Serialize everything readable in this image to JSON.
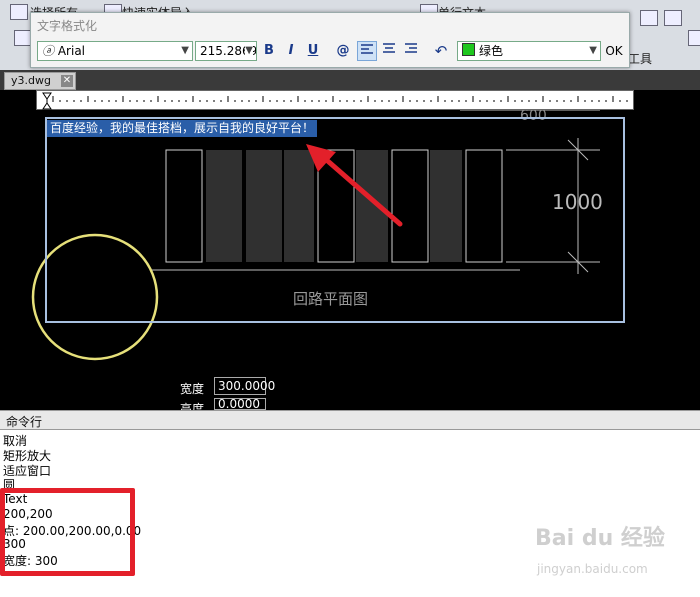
{
  "ribbon": {
    "select_all": "选择所有",
    "quick_import": "快速实体导入",
    "single_text": "单行文本",
    "tools": "工具"
  },
  "tab": {
    "name": "y3.dwg",
    "close_glyph": "✕"
  },
  "dialog": {
    "title": "文字格式化",
    "font": "Arial",
    "size": "215.2869",
    "bold": "B",
    "italic": "I",
    "underline": "U",
    "symbol": "@",
    "color": "绿色",
    "ok": "OK",
    "color_hex": "#1ec71e"
  },
  "canvas": {
    "selected_text": "百度经验，我的最佳搭档，展示自我的良好平台！",
    "plan_label": "回路平面图",
    "dim_1000": "1000",
    "dim_top": "600"
  },
  "properties": {
    "width_label": "宽度",
    "width_value": "300.0000",
    "height_label": "高度",
    "height_value": "0.0000"
  },
  "command": {
    "title": "命令行",
    "lines": [
      "取消",
      "矩形放大",
      "适应窗口",
      "圆",
      "Text",
      "200,200",
      "点: 200.00,200.00,0.00",
      "300",
      "宽度: 300"
    ]
  },
  "watermark": {
    "brand": "Bai du 经验",
    "url": "jingyan.baidu.com"
  }
}
